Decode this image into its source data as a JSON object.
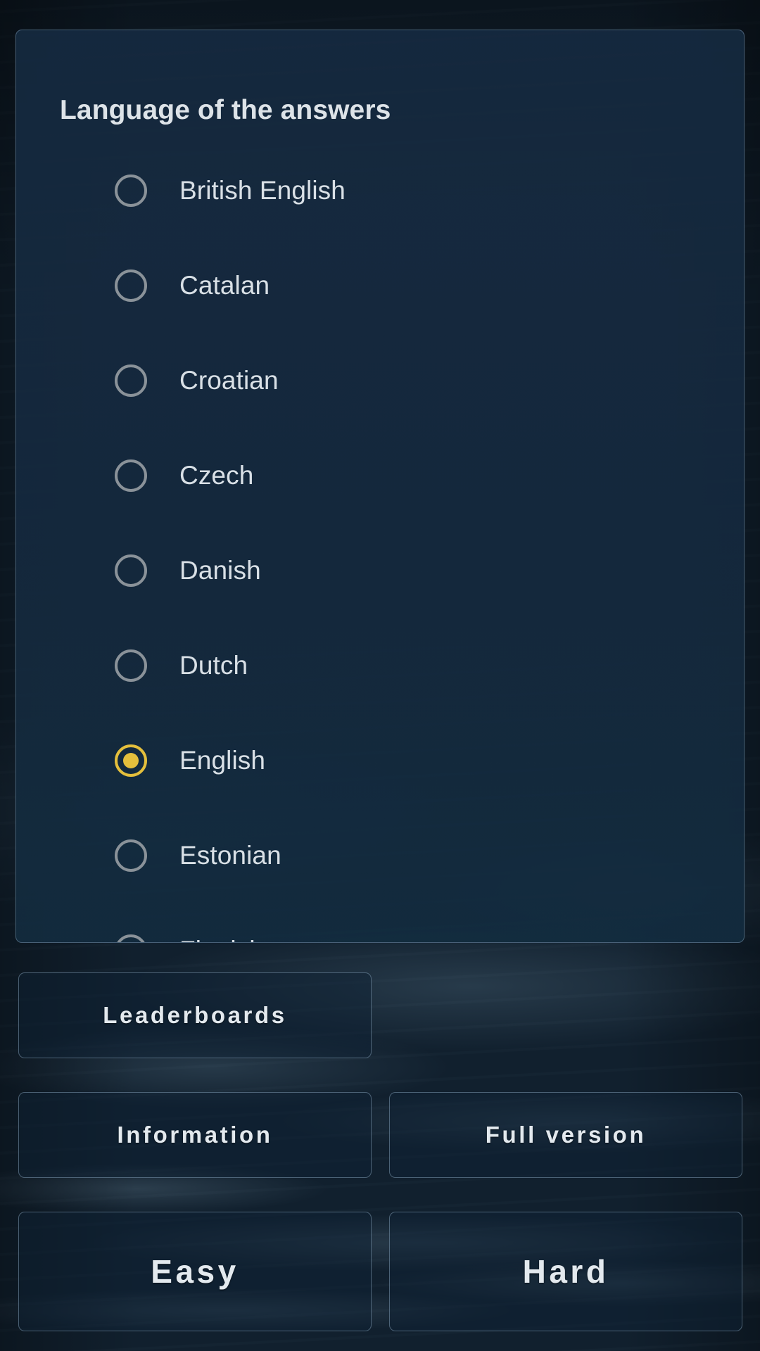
{
  "background": {
    "description": "dark-ocean-night-photo",
    "base_color": "#11202e"
  },
  "dialog": {
    "title": "Language of the answers",
    "accent_color": "#e4bf3c",
    "text_color": "#d9e0e6",
    "panel_color": "#162a40",
    "selected_value": "English",
    "options": [
      {
        "label": "British English",
        "selected": false
      },
      {
        "label": "Catalan",
        "selected": false
      },
      {
        "label": "Croatian",
        "selected": false
      },
      {
        "label": "Czech",
        "selected": false
      },
      {
        "label": "Danish",
        "selected": false
      },
      {
        "label": "Dutch",
        "selected": false
      },
      {
        "label": "English",
        "selected": true
      },
      {
        "label": "Estonian",
        "selected": false
      },
      {
        "label": "Finnish",
        "selected": false
      }
    ]
  },
  "menu": {
    "leaderboards": "Leaderboards",
    "information": "Information",
    "full_version": "Full version",
    "easy": "Easy",
    "hard": "Hard"
  }
}
